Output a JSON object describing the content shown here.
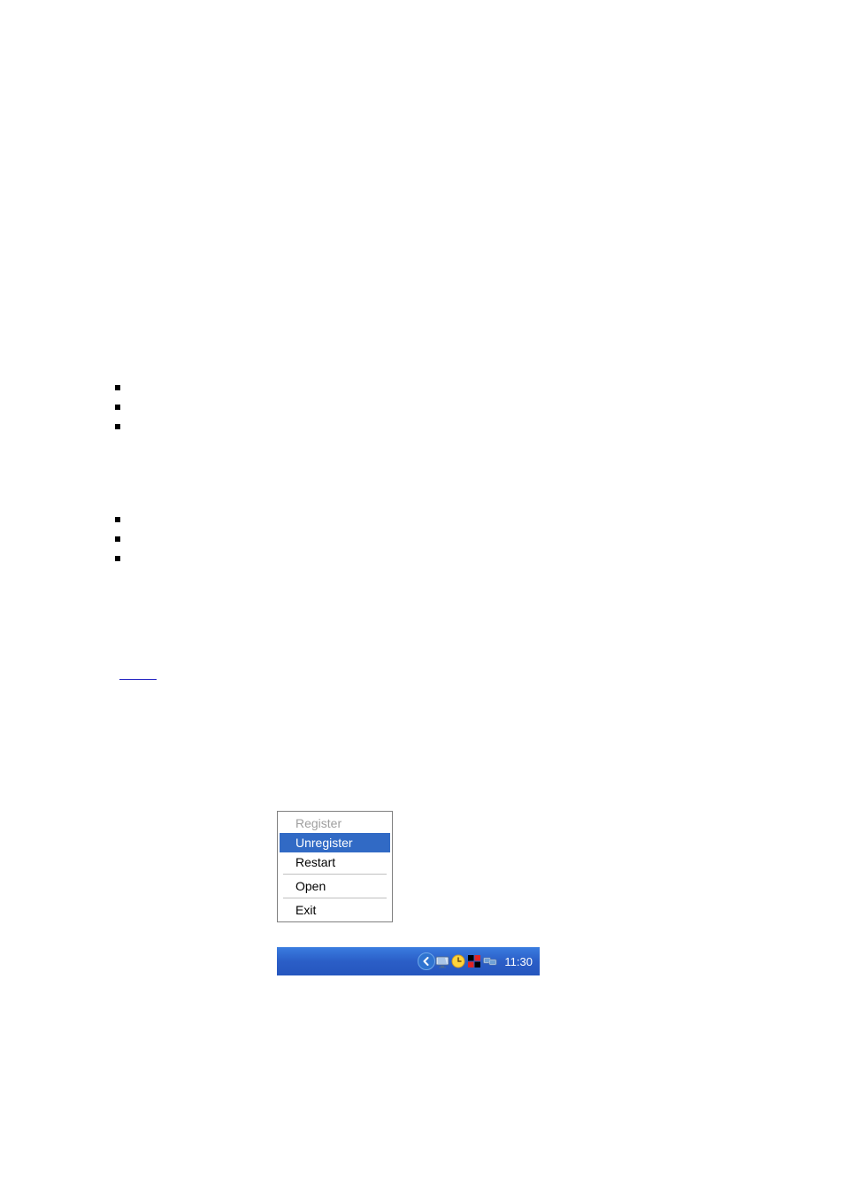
{
  "menu": {
    "register": "Register",
    "unregister": "Unregister",
    "restart": "Restart",
    "open": "Open",
    "exit": "Exit"
  },
  "taskbar": {
    "clock": "11:30"
  }
}
